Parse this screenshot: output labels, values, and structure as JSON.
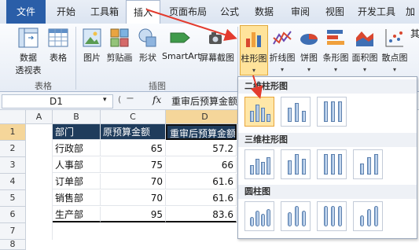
{
  "tabs": [
    "文件",
    "开始",
    "工具箱",
    "插入",
    "页面布局",
    "公式",
    "数据",
    "审阅",
    "视图",
    "开发工具",
    "加"
  ],
  "ribbon": {
    "pivot_label_1": "数据",
    "pivot_label_2": "透视表",
    "table_label": "表格",
    "picture_label": "图片",
    "clipart_label": "剪贴画",
    "shape_label": "形状",
    "smartart_label": "SmartArt",
    "screenshot_label": "屏幕截图",
    "column_chart_label": "柱形图",
    "line_chart_label": "折线图",
    "pie_chart_label": "饼图",
    "bar_chart_label": "条形图",
    "area_chart_label": "面积图",
    "scatter_chart_label": "散点图",
    "group_table": "表格",
    "group_illustrations": "插图"
  },
  "formula_bar": {
    "name_box": "D1",
    "fx": "fx",
    "content": "重审后预算金额"
  },
  "sheet": {
    "columns": [
      "A",
      "B",
      "C",
      "D"
    ],
    "rows": [
      "1",
      "2",
      "3",
      "4",
      "5",
      "6",
      "7",
      "8"
    ],
    "header": [
      "部门",
      "原预算金额",
      "重审后预算金额"
    ],
    "data": [
      [
        "行政部",
        "65",
        "57.2"
      ],
      [
        "人事部",
        "75",
        "66"
      ],
      [
        "订单部",
        "70",
        "61.6"
      ],
      [
        "销售部",
        "70",
        "61.6"
      ],
      [
        "生产部",
        "95",
        "83.6"
      ]
    ]
  },
  "gallery": {
    "section_2d": "二维柱形图",
    "section_3d": "三维柱形图",
    "section_cyl": "圆柱图"
  },
  "colors": {
    "file_tab": "#2a5ea8",
    "header_fill": "#1f3c5c",
    "arrow": "#e33b2e",
    "selection": "#e8a53a"
  }
}
